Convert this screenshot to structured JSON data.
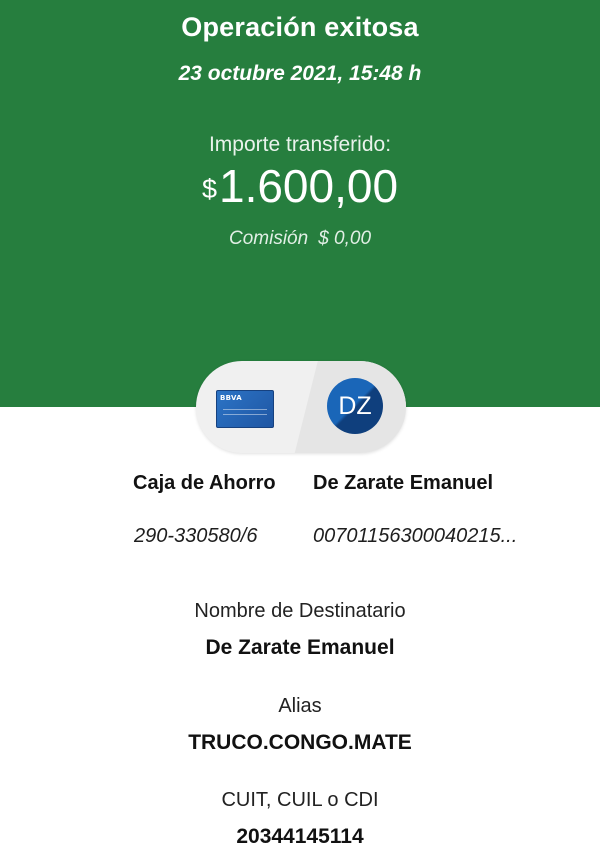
{
  "header": {
    "title": "Operación exitosa",
    "datetime": "23 octubre 2021, 15:48 h",
    "amount_label": "Importe transferido:",
    "currency_symbol": "$",
    "amount": "1.600,00",
    "commission_label": "Comisión",
    "commission_value": "$ 0,00",
    "background_color": "#267e3e"
  },
  "transfer": {
    "origin": {
      "icon": "bbva-card-icon",
      "card_logo": "BBVA",
      "account_type": "Caja de Ahorro",
      "account_number": "290-330580/6"
    },
    "destination": {
      "avatar_initials": "DZ",
      "name": "De Zarate Emanuel",
      "account_number": "00701156300040215..."
    }
  },
  "details": [
    {
      "label": "Nombre de Destinatario",
      "value": "De Zarate Emanuel"
    },
    {
      "label": "Alias",
      "value": "TRUCO.CONGO.MATE"
    },
    {
      "label": "CUIT, CUIL o CDI",
      "value": "20344145114"
    }
  ]
}
